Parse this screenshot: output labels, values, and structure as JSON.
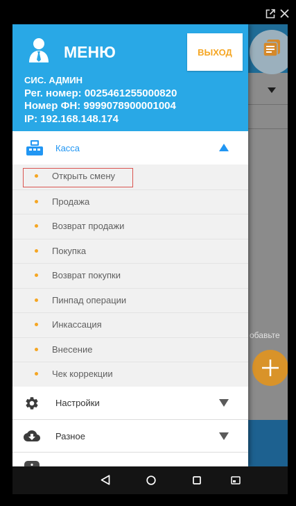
{
  "window_controls": {
    "popout_icon": "popout-icon",
    "close_icon": "close-icon"
  },
  "colors": {
    "header": "#29a8e6",
    "accent": "#f5a623",
    "kassa": "#2196f3",
    "highlight": "#d9534f"
  },
  "menu": {
    "avatar_icon": "user-icon",
    "title": "МЕНЮ",
    "logout": "ВЫХОД",
    "user": "СИС. АДМИН",
    "reg_number": "Рег. номер: 0025461255000820",
    "fn_number": "Номер ФН: 9999078900001004",
    "ip": "IP: 192.168.148.174"
  },
  "sections": {
    "kassa": {
      "label": "Касса",
      "icon": "cash-register-icon",
      "expanded": true,
      "items": [
        {
          "label": "Открыть смену",
          "highlighted": true
        },
        {
          "label": "Продажа",
          "highlighted": false
        },
        {
          "label": "Возврат продажи",
          "highlighted": false
        },
        {
          "label": "Покупка",
          "highlighted": false
        },
        {
          "label": "Возврат покупки",
          "highlighted": false
        },
        {
          "label": "Пинпад операции",
          "highlighted": false
        },
        {
          "label": "Инкассация",
          "highlighted": false
        },
        {
          "label": "Внесение",
          "highlighted": false
        },
        {
          "label": "Чек коррекции",
          "highlighted": false
        }
      ]
    },
    "settings": {
      "label": "Настройки",
      "icon": "gear-icon",
      "expanded": false
    },
    "misc": {
      "label": "Разное",
      "icon": "cloud-download-icon",
      "expanded": false
    },
    "partial": {
      "icon": "info-icon"
    }
  },
  "background_app": {
    "list_icon": "list-icon",
    "dropdown_icon": "dropdown-arrow-icon",
    "hint_fragment": "обавьте",
    "add_icon": "plus-icon"
  },
  "nav_bar": {
    "back_icon": "back-icon",
    "home_icon": "home-icon",
    "recents_icon": "recents-icon",
    "screenshot_icon": "screenshot-icon"
  }
}
